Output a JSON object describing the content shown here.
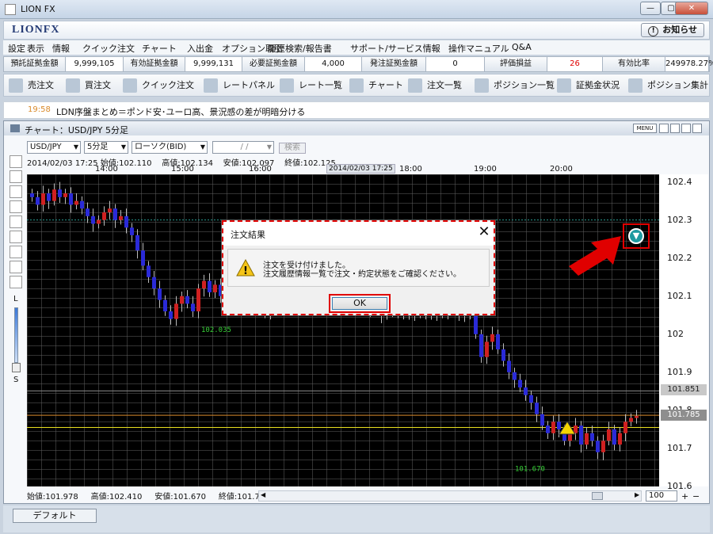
{
  "window": {
    "title": "LION FX",
    "min": "—",
    "restore": "▢",
    "close": "✕"
  },
  "brand": {
    "logo": "LIONFX",
    "notice": "お知らせ",
    "notice_icon": "!"
  },
  "menu": [
    "設定",
    "表示",
    "情報",
    "クイック注文",
    "チャート",
    "入出金",
    "オプション取引",
    "履歴検索/報告書",
    "サポート/サービス情報",
    "操作マニュアル",
    "Q&A"
  ],
  "margins": [
    {
      "label": "預託証拠金額",
      "value": "9,999,105"
    },
    {
      "label": "有効証拠金額",
      "value": "9,999,131"
    },
    {
      "label": "必要証拠金額",
      "value": "4,000"
    },
    {
      "label": "発注証拠金額",
      "value": "0"
    },
    {
      "label": "評価損益",
      "value": "26",
      "value_color": "#e00000"
    },
    {
      "label": "有効比率",
      "value": "249978.27%"
    }
  ],
  "toolbar": [
    {
      "label": "売注文",
      "icon": "sell-arrow-icon"
    },
    {
      "label": "買注文",
      "icon": "buy-arrow-icon"
    },
    {
      "label": "クイック注文",
      "icon": "quick-order-icon"
    },
    {
      "label": "レートパネル",
      "icon": "rate-panel-icon"
    },
    {
      "label": "レート一覧",
      "icon": "rate-list-icon"
    },
    {
      "label": "チャート",
      "icon": "chart-icon"
    },
    {
      "label": "注文一覧",
      "icon": "order-list-icon"
    },
    {
      "label": "ポジション一覧",
      "icon": "position-icon"
    },
    {
      "label": "証拠金状況",
      "icon": "yen-icon"
    },
    {
      "label": "ポジション集計",
      "icon": "summary-icon"
    }
  ],
  "news": {
    "time": "19:58",
    "headline": "LDN序盤まとめ＝ポンド安･ユーロ高、景況感の差が明暗分ける"
  },
  "chart_window": {
    "title": "チャート：USD/JPY 5分足",
    "menu": "MENU"
  },
  "chart_controls": {
    "pair": "USD/JPY",
    "timeframe": "5分足",
    "type": "ローソク(BID)",
    "date_placeholder": "/ /",
    "search": "検索"
  },
  "ohlc_top": "2014/02/03 17:25 始値:102.110    高値:102.134    安値:102.097    終値:102.125",
  "ohlc_bottom": "始値:101.978     高値:102.410     安値:101.670     終値:101.785",
  "slider": {
    "top": "L",
    "bottom": "S"
  },
  "zoom": "100",
  "bottom_tab": "デフォルト",
  "chart_data": {
    "type": "candlestick",
    "pair": "USD/JPY",
    "timeframe": "5分足",
    "x_ticks": [
      "14:00",
      "15:00",
      "16:00",
      "2014/02/03 17:25",
      "18:00",
      "19:00",
      "20:00"
    ],
    "y_ticks": [
      102.4,
      102.3,
      102.2,
      102.1,
      102.0,
      101.9,
      101.8,
      101.7,
      101.6
    ],
    "y_range": [
      101.6,
      102.42
    ],
    "price_marks": [
      {
        "label": "101.851",
        "value": 101.851
      },
      {
        "label": "101.785",
        "value": 101.785
      }
    ],
    "annotations": [
      {
        "text": "102.035",
        "value": 102.035
      },
      {
        "text": "101.670",
        "value": 101.67
      }
    ],
    "colors": {
      "up": "#d02020",
      "down": "#2a2ad8",
      "background": "#000000"
    },
    "candles_close": [
      102.36,
      102.34,
      102.37,
      102.35,
      102.38,
      102.36,
      102.37,
      102.34,
      102.35,
      102.33,
      102.31,
      102.29,
      102.3,
      102.32,
      102.33,
      102.3,
      102.31,
      102.28,
      102.26,
      102.22,
      102.18,
      102.15,
      102.12,
      102.09,
      102.06,
      102.04,
      102.08,
      102.1,
      102.08,
      102.06,
      102.12,
      102.14,
      102.11,
      102.13,
      102.1,
      102.12,
      102.09,
      102.11,
      102.08,
      102.1,
      102.07,
      102.09,
      102.06,
      102.08,
      102.1,
      102.09,
      102.11,
      102.1,
      102.12,
      102.11,
      102.1,
      102.09,
      102.1,
      102.08,
      102.09,
      102.1,
      102.08,
      102.09,
      102.07,
      102.08,
      102.06,
      102.08,
      102.07,
      102.05,
      102.07,
      102.06,
      102.08,
      102.06,
      102.05,
      102.07,
      102.06,
      102.08,
      102.05,
      102.07,
      102.06,
      102.08,
      102.07,
      102.05,
      102.06,
      102.07,
      102.0,
      101.94,
      101.98,
      102.0,
      101.96,
      101.93,
      101.9,
      101.88,
      101.86,
      101.84,
      101.82,
      101.79,
      101.76,
      101.74,
      101.77,
      101.75,
      101.72,
      101.74,
      101.76,
      101.71,
      101.74,
      101.72,
      101.69,
      101.72,
      101.75,
      101.71,
      101.74,
      101.77,
      101.78,
      101.785
    ]
  },
  "dialog": {
    "title": "注文結果",
    "close": "✕",
    "line1": "注文を受け付けました。",
    "line2": "注文履歴情報一覧で注文・約定状態をご確認ください。",
    "ok": "OK"
  }
}
